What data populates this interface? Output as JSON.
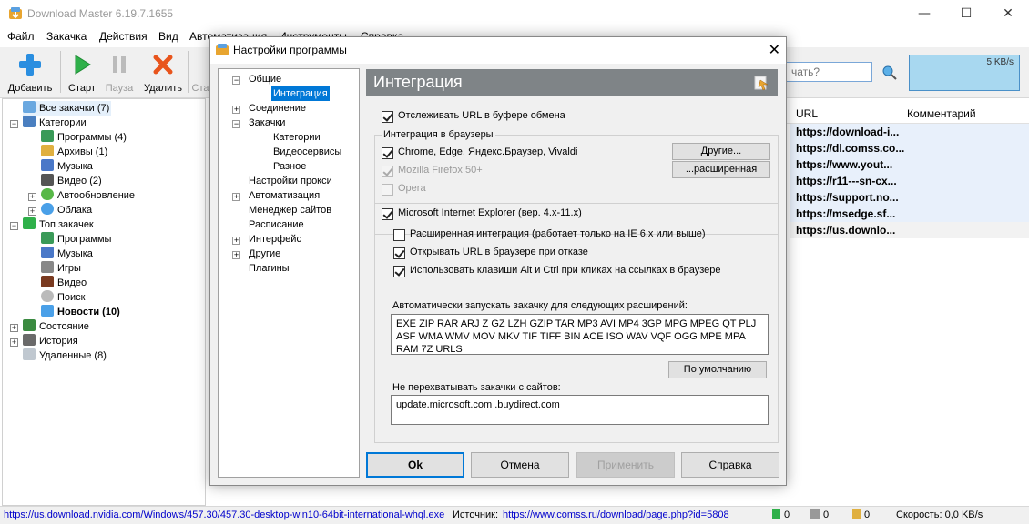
{
  "window": {
    "title": "Download Master 6.19.7.1655",
    "minimize": "—",
    "maximize": "☐",
    "close": "✕"
  },
  "menu": [
    "Файл",
    "Закачка",
    "Действия",
    "Вид",
    "Автоматизация",
    "Инструменты",
    "Справка"
  ],
  "toolbar": {
    "add": "Добавить",
    "start": "Старт",
    "pause": "Пауза",
    "delete": "Удалить",
    "stop": "Ста",
    "search_placeholder": "чать?",
    "speed": "5 KB/s"
  },
  "tree": {
    "all": "Все закачки (7)",
    "categories": "Категории",
    "programs": "Программы (4)",
    "archives": "Архивы (1)",
    "music": "Музыка",
    "video": "Видео (2)",
    "autoupdate": "Автообновление",
    "cloud": "Облака",
    "top": "Топ закачек",
    "top_programs": "Программы",
    "top_music": "Музыка",
    "top_games": "Игры",
    "top_video": "Видео",
    "top_search": "Поиск",
    "top_news": "Новости (10)",
    "state": "Состояние",
    "history": "История",
    "deleted": "Удаленные (8)"
  },
  "list": {
    "col_url": "URL",
    "col_comment": "Комментарий",
    "rows": [
      "https://download-i...",
      "https://dl.comss.co...",
      "https://www.yout...",
      "https://r11---sn-cx...",
      "https://support.no...",
      "https://msedge.sf...",
      "https://us.downlo..."
    ]
  },
  "statusbar": {
    "url": "https://us.download.nvidia.com/Windows/457.30/457.30-desktop-win10-64bit-international-whql.exe",
    "source_label": "Источник:",
    "source": "https://www.comss.ru/download/page.php?id=5808",
    "active": "0",
    "queued": "0",
    "done": "0",
    "speed": "Скорость: 0,0 KB/s"
  },
  "dialog": {
    "title": "Настройки программы",
    "close": "✕",
    "tree": {
      "general": "Общие",
      "integration": "Интеграция",
      "connection": "Соединение",
      "downloads": "Закачки",
      "categories": "Категории",
      "videoservices": "Видеосервисы",
      "misc": "Разное",
      "proxy": "Настройки прокси",
      "automation": "Автоматизация",
      "sitemanager": "Менеджер сайтов",
      "schedule": "Расписание",
      "interface": "Интерфейс",
      "other": "Другие",
      "plugins": "Плагины"
    },
    "header": "Интеграция",
    "track_clipboard": "Отслеживать URL в буфере обмена",
    "browser_group": "Интеграция в браузеры",
    "chrome": "Chrome, Edge, Яндекс.Браузер, Vivaldi",
    "firefox": "Mozilla Firefox 50+",
    "opera": "Opera",
    "btn_others": "Другие...",
    "btn_extended": "...расширенная",
    "ie": "Microsoft Internet Explorer (вер. 4.x-11.x)",
    "ie_extended": "Расширенная интеграция (работает только на IE 6.x или выше)",
    "ie_open_on_refuse": "Открывать URL в браузере при отказе",
    "ie_alt_ctrl": "Использовать клавиши Alt и Ctrl при кликах на ссылках в браузере",
    "ext_label": "Автоматически запускать закачку для следующих расширений:",
    "extensions": "EXE ZIP RAR ARJ Z GZ LZH GZIP TAR MP3 AVI MP4 3GP MPG MPEG QT PLJ ASF WMA WMV MOV MKV TIF TIFF BIN ACE ISO WAV VQF OGG MPE MPA RAM 7Z URLS",
    "btn_default": "По умолчанию",
    "exclude_label": "Не перехватывать закачки с сайтов:",
    "exclude_sites": "update.microsoft.com .buydirect.com",
    "ok": "Ok",
    "cancel": "Отмена",
    "apply": "Применить",
    "help": "Справка"
  },
  "colors": {
    "accent": "#0078d7",
    "header_bg": "#7f8487",
    "speed_graph": "#a8d8f0",
    "row_highlight": "#e8f0fb"
  }
}
